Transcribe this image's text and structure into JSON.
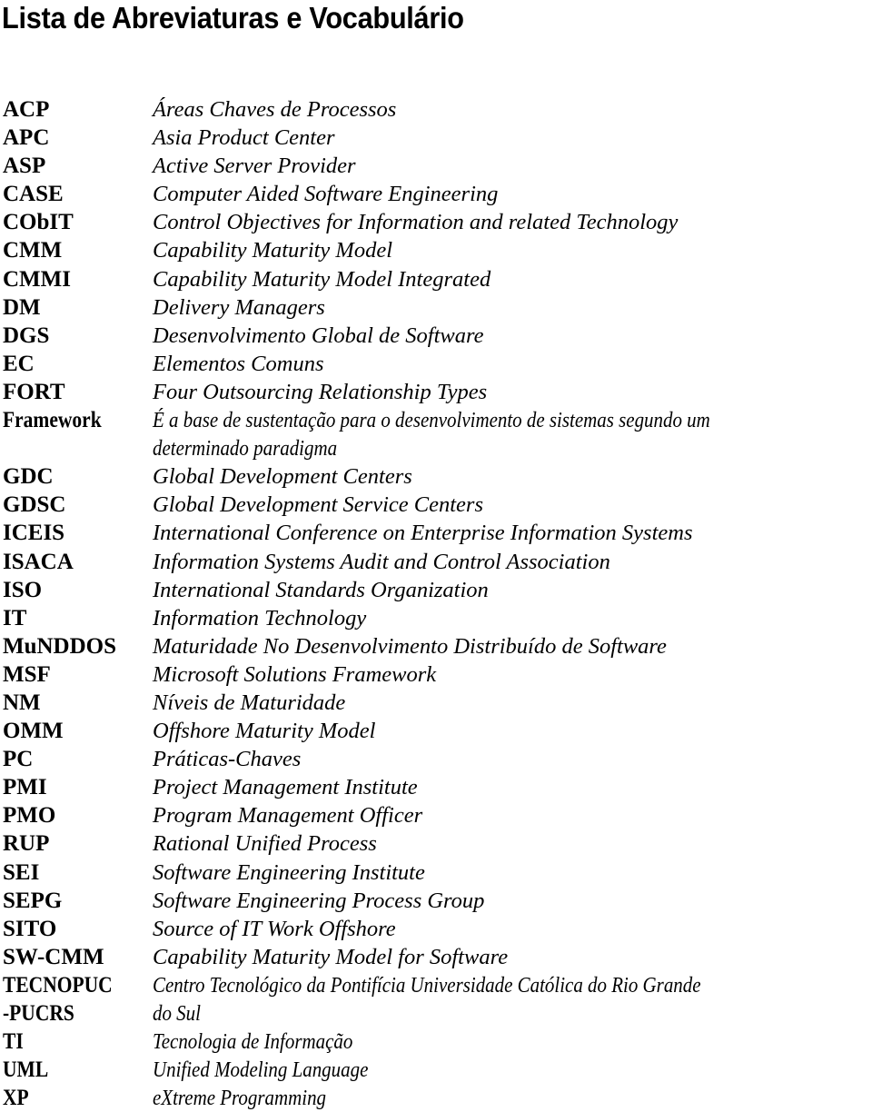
{
  "page": {
    "title": "Lista de Abreviaturas e Vocabulário"
  },
  "entries": [
    {
      "term": "ACP",
      "definition": "Áreas Chaves de Processos"
    },
    {
      "term": "APC",
      "definition": "Asia Product Center"
    },
    {
      "term": "ASP",
      "definition": "Active Server Provider"
    },
    {
      "term": "CASE",
      "definition": "Computer Aided Software Engineering"
    },
    {
      "term": "CObIT",
      "definition": "Control Objectives for Information and related Technology"
    },
    {
      "term": "CMM",
      "definition": "Capability Maturity Model"
    },
    {
      "term": "CMMI",
      "definition": "Capability Maturity Model Integrated"
    },
    {
      "term": "DM",
      "definition": "Delivery Managers"
    },
    {
      "term": "DGS",
      "definition": "Desenvolvimento Global de Software"
    },
    {
      "term": "EC",
      "definition": "Elementos Comuns"
    },
    {
      "term": "FORT",
      "definition": "Four Outsourcing Relationship Types"
    },
    {
      "term": "Framework",
      "definition": "É a base de sustentação para o desenvolvimento de sistemas segundo um determinado paradigma"
    },
    {
      "term": "GDC",
      "definition": "Global Development Centers"
    },
    {
      "term": "GDSC",
      "definition": "Global Development Service Centers"
    },
    {
      "term": "ICEIS",
      "definition": "International Conference on Enterprise Information Systems"
    },
    {
      "term": "ISACA",
      "definition": "Information Systems Audit and Control Association"
    },
    {
      "term": "ISO",
      "definition": "International Standards Organization"
    },
    {
      "term": "IT",
      "definition": "Information Technology"
    },
    {
      "term": "MuNDDOS",
      "definition": "Maturidade No Desenvolvimento Distribuído de Software"
    },
    {
      "term": "MSF",
      "definition": "Microsoft Solutions Framework"
    },
    {
      "term": "NM",
      "definition": "Níveis de Maturidade"
    },
    {
      "term": "OMM",
      "definition": "Offshore Maturity Model"
    },
    {
      "term": "PC",
      "definition": "Práticas-Chaves"
    },
    {
      "term": "PMI",
      "definition": "Project Management Institute"
    },
    {
      "term": "PMO",
      "definition": "Program Management Officer"
    },
    {
      "term": "RUP",
      "definition": "Rational Unified Process"
    },
    {
      "term": "SEI",
      "definition": "Software Engineering Institute"
    },
    {
      "term": "SEPG",
      "definition": "Software Engineering Process Group"
    },
    {
      "term": "SITO",
      "definition": "Source of IT Work Offshore"
    },
    {
      "term": "SW-CMM",
      "definition": "Capability Maturity Model for Software"
    },
    {
      "term": "TECNOPUC -PUCRS",
      "definition": "Centro Tecnológico da Pontifícia Universidade Católica do Rio Grande do Sul"
    },
    {
      "term": "TI",
      "definition": "Tecnologia de Informação"
    },
    {
      "term": "UML",
      "definition": "Unified Modeling Language"
    },
    {
      "term": "XP",
      "definition": "eXtreme Programming"
    }
  ],
  "wrapped": {
    "framework_line1": "É a base de sustentação para o desenvolvimento de sistemas segundo um",
    "framework_line2": "determinado paradigma",
    "tecnopuc_term_line1": "TECNOPUC",
    "tecnopuc_term_line2": "-PUCRS",
    "tecnopuc_def_line1": "Centro Tecnológico da Pontifícia Universidade Católica do Rio Grande",
    "tecnopuc_def_line2": "do Sul"
  }
}
